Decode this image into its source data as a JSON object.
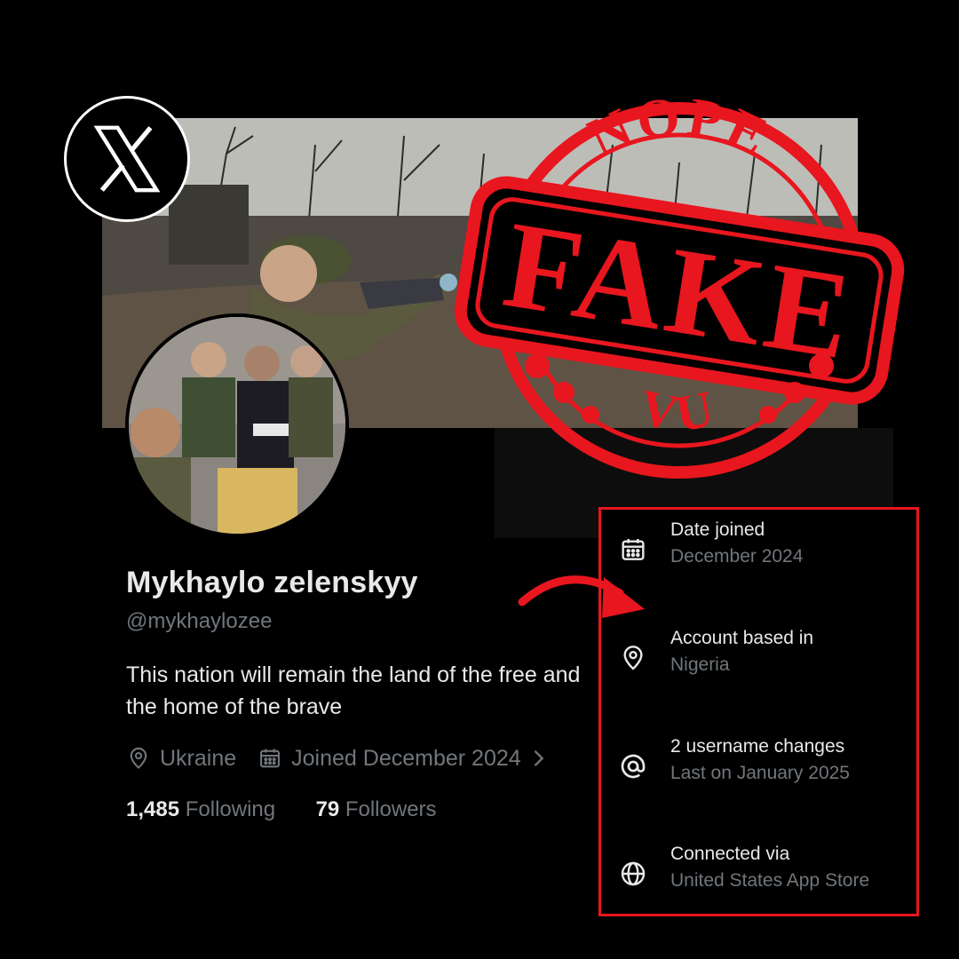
{
  "logo": {
    "name": "X"
  },
  "profile": {
    "display_name": "Mykhaylo zelenskyy",
    "handle": "@mykhaylozee",
    "bio": "This nation will remain the land of the free and the home of the brave",
    "location": "Ukraine",
    "joined": "Joined December 2024",
    "following_count": "1,485",
    "following_label": "Following",
    "followers_count": "79",
    "followers_label": "Followers"
  },
  "about_account": {
    "items": [
      {
        "icon": "calendar-icon",
        "title": "Date joined",
        "value": "December 2024"
      },
      {
        "icon": "location-pin-icon",
        "title": "Account based in",
        "value": "Nigeria"
      },
      {
        "icon": "at-sign-icon",
        "title": "2 username changes",
        "value": "Last on January 2025"
      },
      {
        "icon": "globe-icon",
        "title": "Connected via",
        "value": "United States App Store"
      }
    ],
    "highlight_color": "#e8161e"
  },
  "stamp": {
    "top_text": "NOPE",
    "main_text": "FAKE",
    "bottom_text": "VU",
    "color": "#e8161e"
  }
}
